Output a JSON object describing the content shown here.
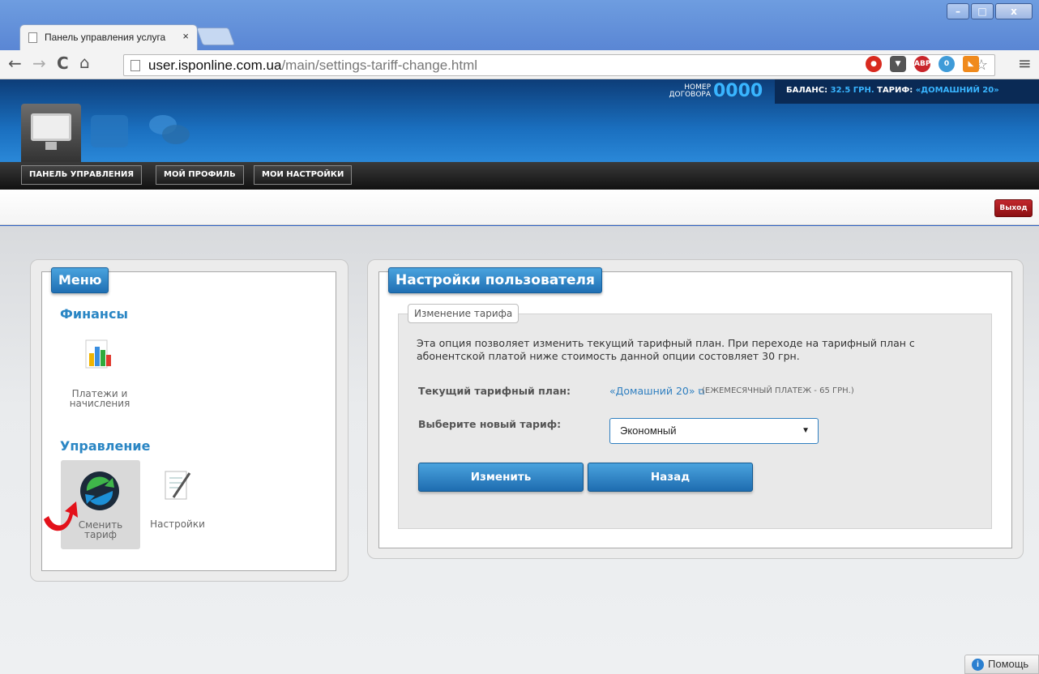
{
  "browser": {
    "tab_title": "Панель управления услуга",
    "tab_close": "×",
    "url_host": "user.isponline.com.ua",
    "url_path": "/main/settings-tariff-change.html",
    "window_buttons": [
      "–",
      "□",
      "x"
    ]
  },
  "header": {
    "contract_label": "НОМЕР ДОГОВОРА",
    "contract_number": "0000",
    "balance_label": "БАЛАНС:",
    "balance_value": "32.5 ГРН.",
    "tariff_label": "ТАРИФ:",
    "tariff_value": "«ДОМАШНИЙ 20»"
  },
  "nav": {
    "items": [
      "ПАНЕЛЬ УПРАВЛЕНИЯ",
      "МОЙ ПРОФИЛЬ",
      "МОИ НАСТРОЙКИ"
    ]
  },
  "logout_label": "Выход",
  "menu": {
    "title": "Меню",
    "finance_heading": "Финансы",
    "payments_label_1": "Платежи и",
    "payments_label_2": "начисления",
    "management_heading": "Управление",
    "change_tariff_1": "Сменить",
    "change_tariff_2": "тариф",
    "settings_label": "Настройки"
  },
  "settings": {
    "title": "Настройки пользователя",
    "legend": "Изменение тарифа",
    "description": "Эта опция позволяет изменить текущий тарифный план. При переходе на тарифный план с абонентской платой ниже стоимость данной опции состовляет 30 грн.",
    "current_label": "Текущий тарифный план:",
    "current_value": "«Домашний 20»",
    "monthly": "(ЕЖЕМЕСЯЧНЫЙ ПЛАТЕЖ - 65 ГРН.)",
    "new_label": "Выберите новый тариф:",
    "selected_tariff": "Экономный",
    "change_button": "Изменить",
    "back_button": "Назад"
  },
  "help_label": "Помощь",
  "colors": {
    "accent": "#2a86c4",
    "header_blue": "#1a6fbf",
    "logout_red": "#b01c21"
  }
}
